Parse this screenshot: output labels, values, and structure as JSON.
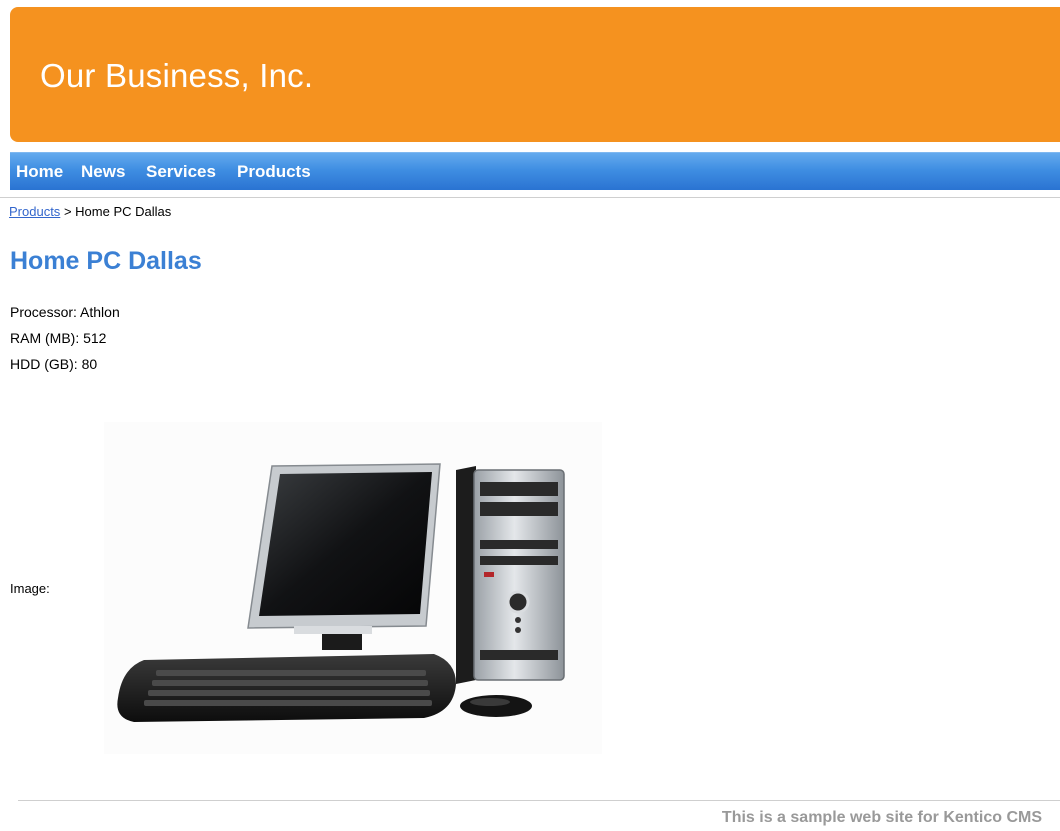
{
  "header": {
    "title": "Our Business, Inc."
  },
  "nav": {
    "items": [
      {
        "label": "Home"
      },
      {
        "label": "News"
      },
      {
        "label": "Services"
      },
      {
        "label": "Products"
      }
    ]
  },
  "breadcrumb": {
    "parent": "Products",
    "separator": ">",
    "current": "Home PC Dallas"
  },
  "product": {
    "title": "Home PC Dallas",
    "specs": [
      {
        "label": "Processor:",
        "value": "Athlon"
      },
      {
        "label": "RAM (MB):",
        "value": "512"
      },
      {
        "label": "HDD (GB):",
        "value": "80"
      }
    ],
    "image_label": "Image:",
    "image_icon": "desktop-computer-icon"
  },
  "footer": {
    "text": "This is a sample web site for Kentico CMS"
  },
  "colors": {
    "header_bg": "#f5921f",
    "menu_bg": "#3f8ee2",
    "title_color": "#3b80d4",
    "link_color": "#3366cc",
    "footer_text": "#999999"
  }
}
